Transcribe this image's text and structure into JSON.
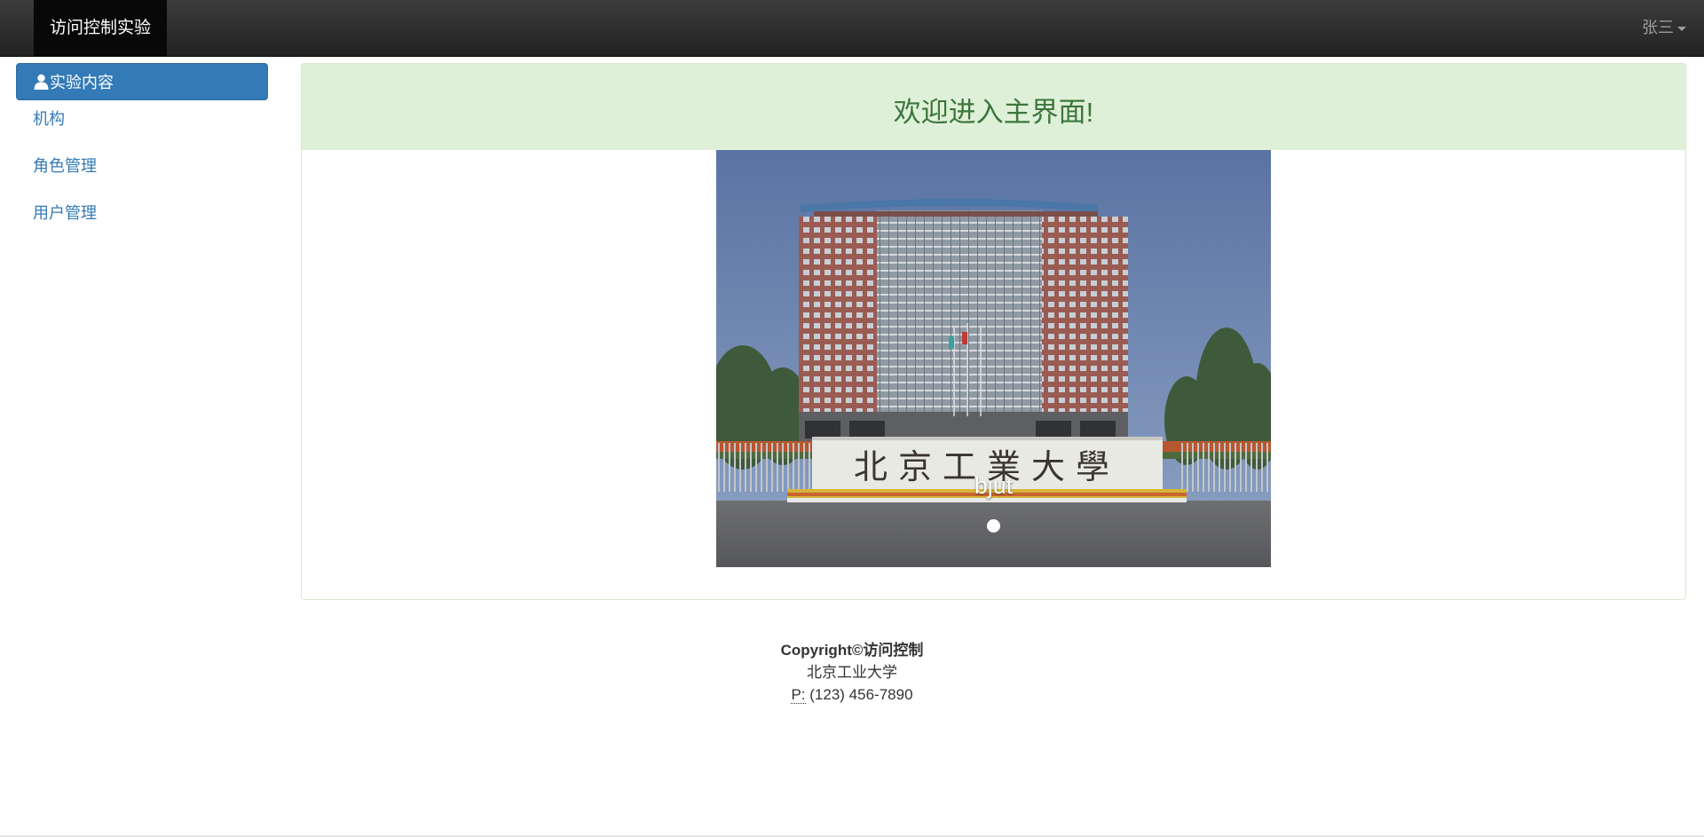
{
  "navbar": {
    "brand": "访问控制实验",
    "user": "张三"
  },
  "sidebar": {
    "items": [
      {
        "label": "实验内容",
        "icon": "user-icon",
        "active": true
      },
      {
        "label": "机构"
      },
      {
        "label": "角色管理"
      },
      {
        "label": "用户管理"
      }
    ]
  },
  "main": {
    "welcome": "欢迎进入主界面!",
    "carousel": {
      "image_description": "photo of a university building with a gate sign",
      "sign_text": "北京工業大學",
      "caption": "bjut",
      "slide_count": 1,
      "active_slide": 1
    }
  },
  "footer": {
    "copyright": "Copyright©访问控制",
    "org": "北京工业大学",
    "phone_label": "P:",
    "phone": "(123) 456-7890"
  },
  "colors": {
    "navbar": "#222222",
    "brand_bg": "#080808",
    "accent": "#337ab7",
    "panel_heading_bg": "#dff0d8",
    "panel_heading_text": "#3c763d"
  }
}
